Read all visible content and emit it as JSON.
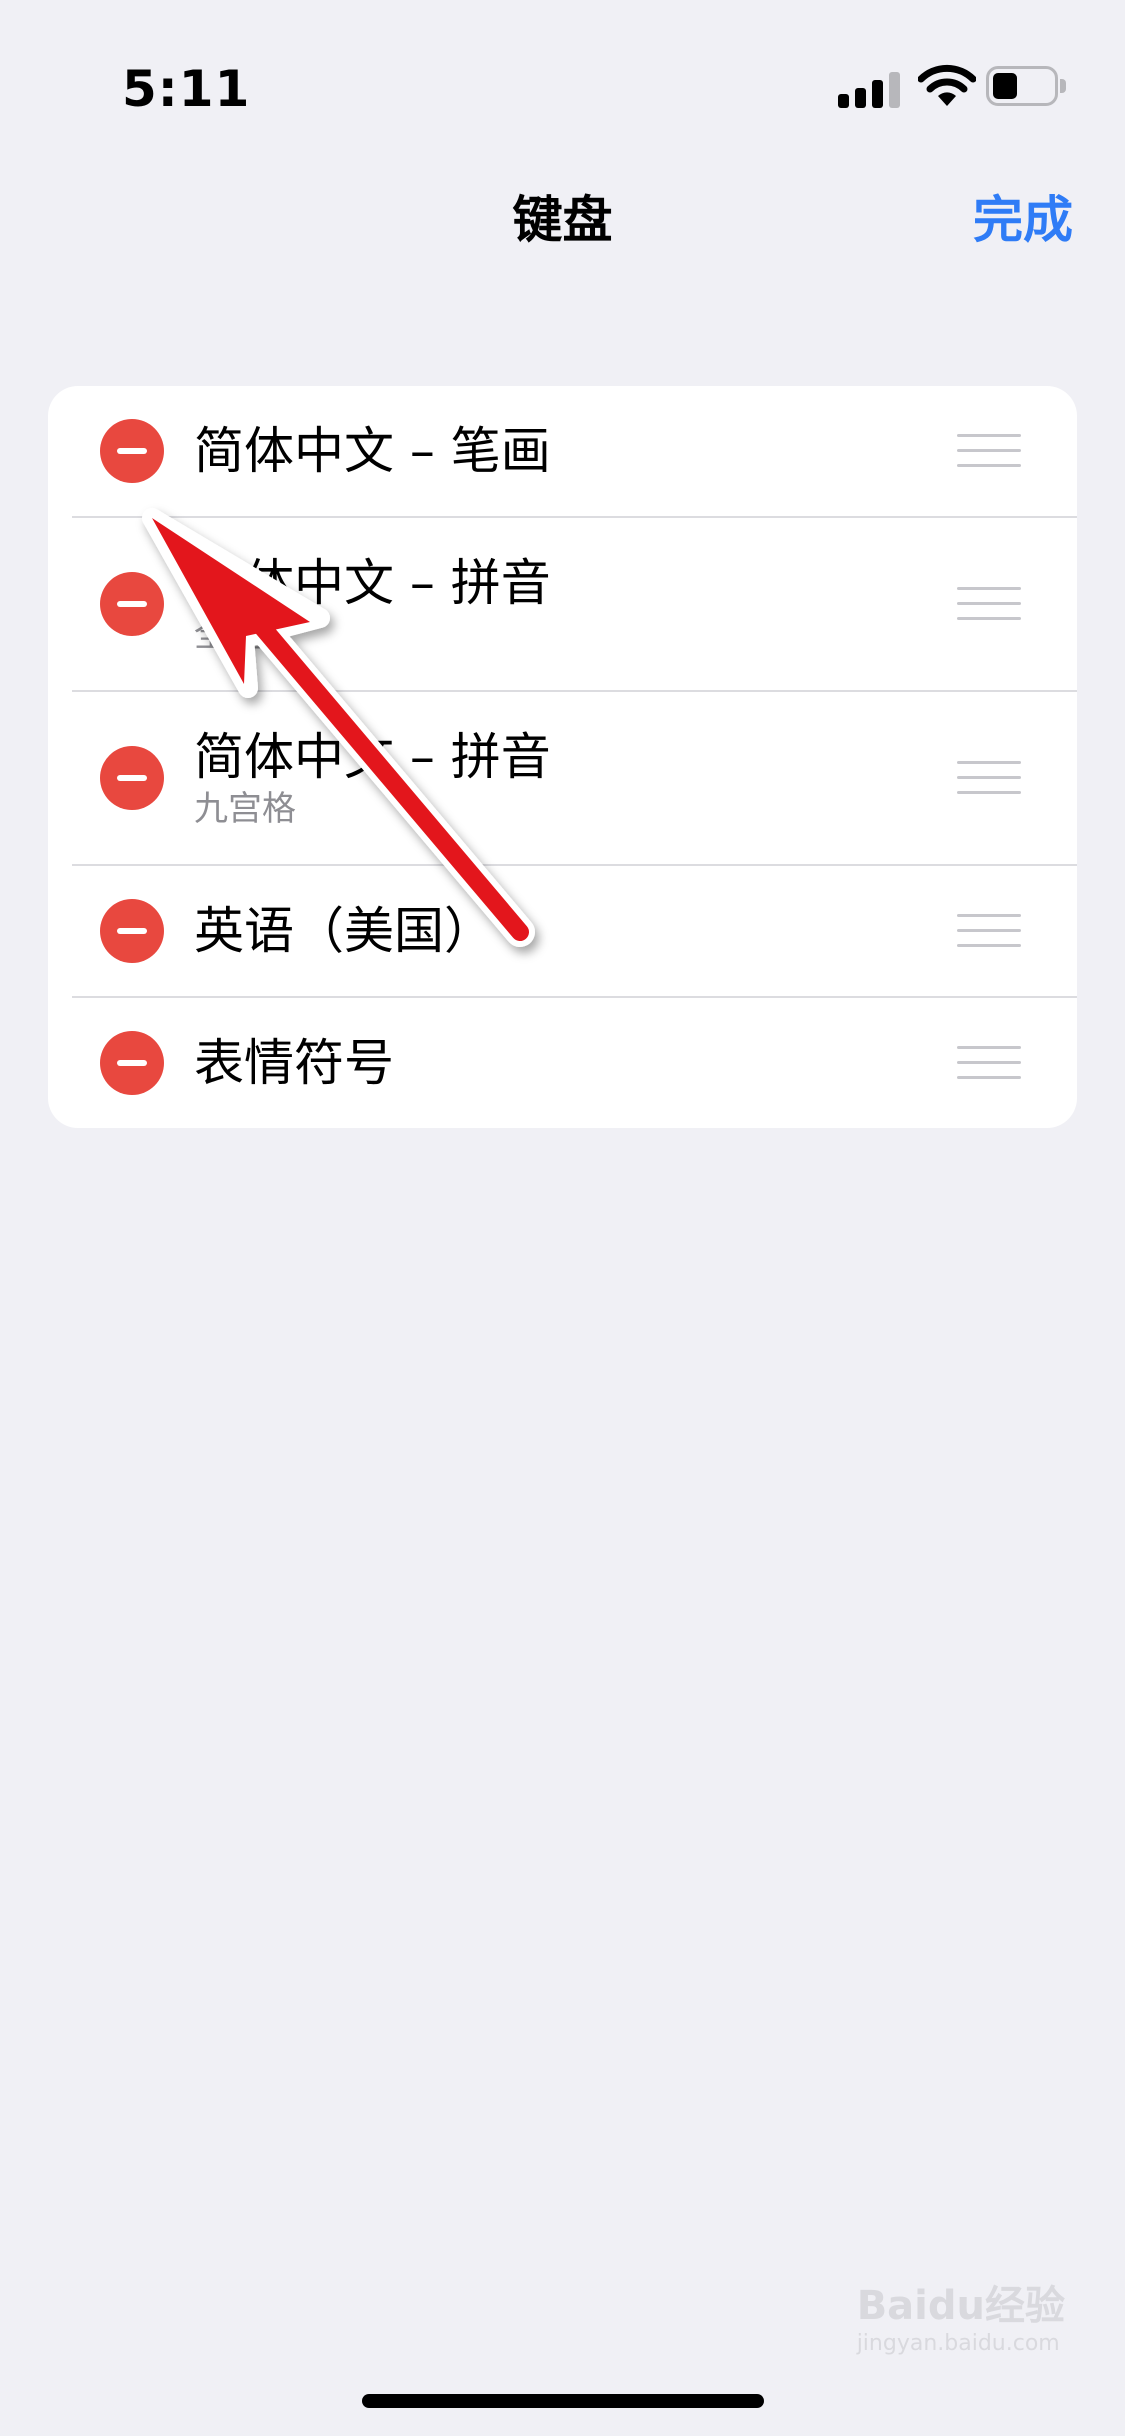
{
  "status_bar": {
    "time": "5:11"
  },
  "nav": {
    "title": "键盘",
    "done_label": "完成"
  },
  "keyboards": [
    {
      "label": "简体中文 – 笔画",
      "sublabel": ""
    },
    {
      "label": "简体中文 – 拼音",
      "sublabel": "全键盘"
    },
    {
      "label": "简体中文 – 拼音",
      "sublabel": "九宫格"
    },
    {
      "label": "英语（美国）",
      "sublabel": ""
    },
    {
      "label": "表情符号",
      "sublabel": ""
    }
  ],
  "watermark": {
    "brand": "Baidu经验",
    "url": "jingyan.baidu.com"
  },
  "colors": {
    "accent": "#2f7cf6",
    "delete": "#e8483f",
    "annotation_arrow": "#e3161b"
  }
}
